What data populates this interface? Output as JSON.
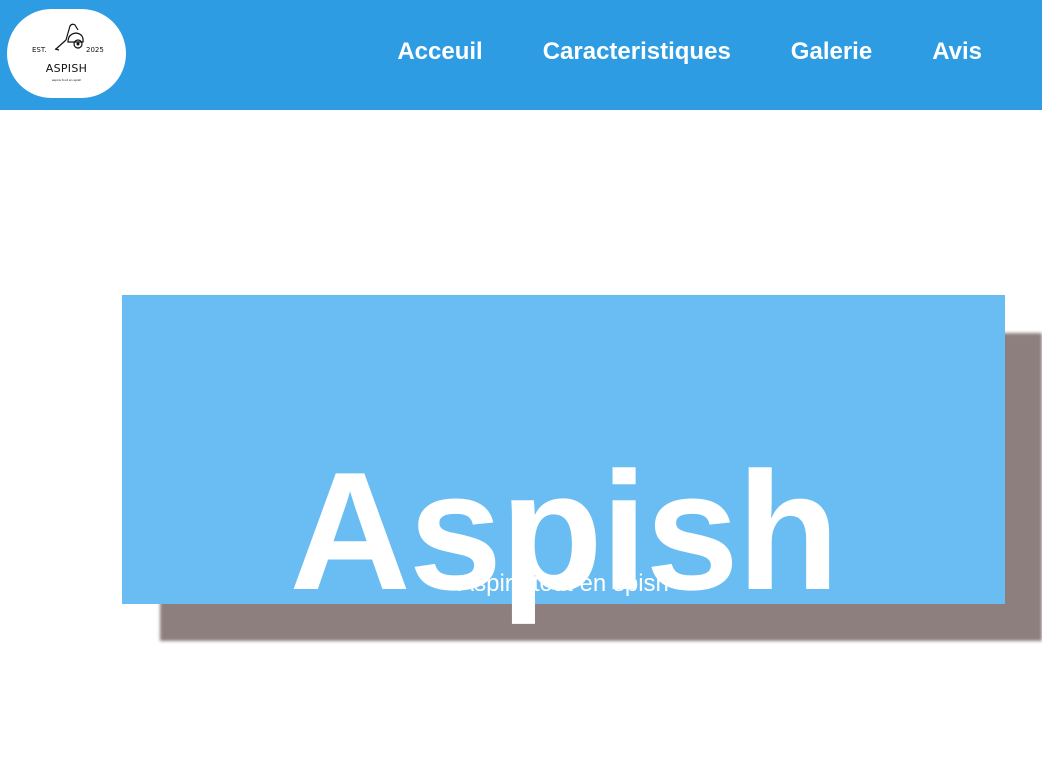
{
  "logo": {
    "est": "EST.",
    "year": "2025",
    "name": "ASPISH",
    "tagline": "aspire tout en spish",
    "icon": "vacuum-cleaner-icon"
  },
  "nav": {
    "items": [
      {
        "label": "Acceuil"
      },
      {
        "label": "Caracteristiques"
      },
      {
        "label": "Galerie"
      },
      {
        "label": "Avis"
      }
    ]
  },
  "hero": {
    "title": "Aspish",
    "subtitle": "Aspire tout en spish"
  },
  "colors": {
    "header": "#2d9ce3",
    "hero": "#6abdf2",
    "shadow": "#8c7f7e",
    "text": "#ffffff"
  }
}
